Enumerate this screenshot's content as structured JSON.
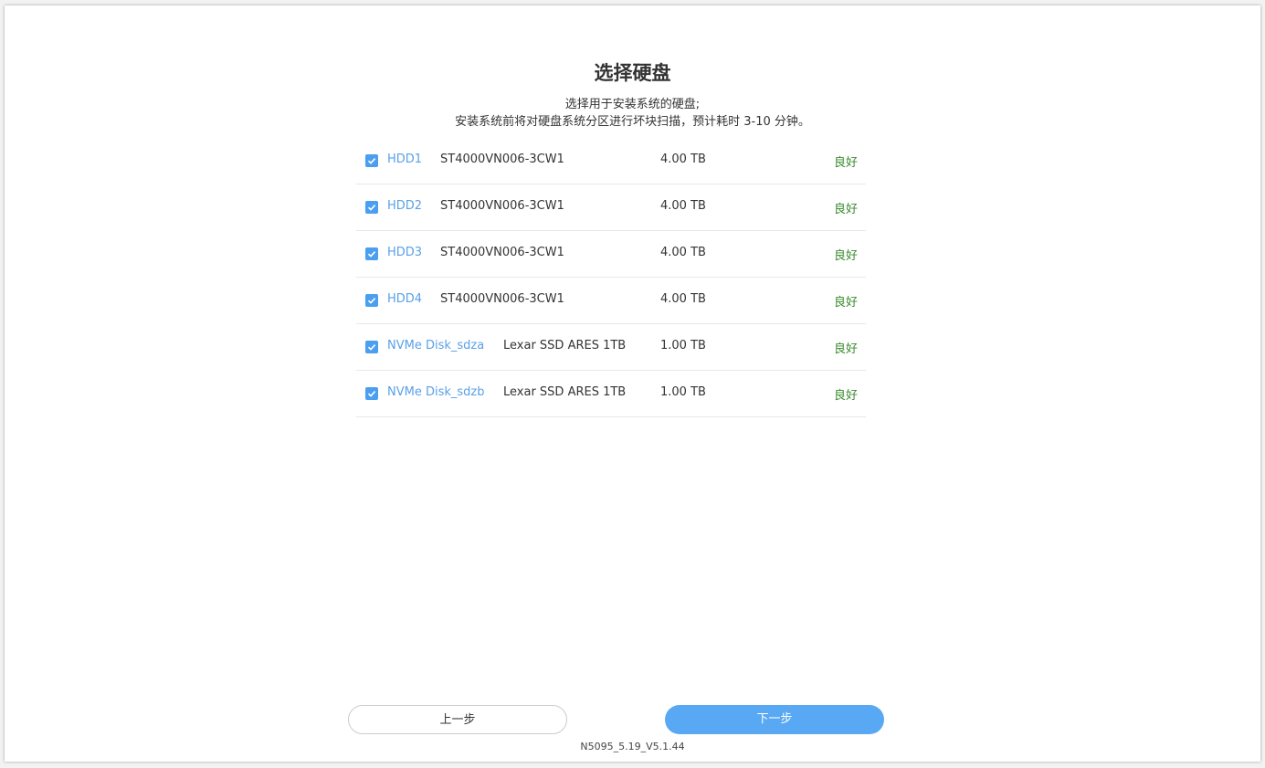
{
  "page": {
    "title": "选择硬盘",
    "subtitle_line1": "选择用于安装系统的硬盘;",
    "subtitle_line2": "安装系统前将对硬盘系统分区进行坏块扫描，预计耗时 3-10 分钟。"
  },
  "disks": [
    {
      "name": "HDD1",
      "model": "ST4000VN006-3CW1",
      "size": "4.00 TB",
      "status": "良好",
      "checked": true
    },
    {
      "name": "HDD2",
      "model": "ST4000VN006-3CW1",
      "size": "4.00 TB",
      "status": "良好",
      "checked": true
    },
    {
      "name": "HDD3",
      "model": "ST4000VN006-3CW1",
      "size": "4.00 TB",
      "status": "良好",
      "checked": true
    },
    {
      "name": "HDD4",
      "model": "ST4000VN006-3CW1",
      "size": "4.00 TB",
      "status": "良好",
      "checked": true
    },
    {
      "name": "NVMe Disk_sdza",
      "model": "Lexar SSD ARES 1TB",
      "size": "1.00 TB",
      "status": "良好",
      "checked": true
    },
    {
      "name": "NVMe Disk_sdzb",
      "model": "Lexar SSD ARES 1TB",
      "size": "1.00 TB",
      "status": "良好",
      "checked": true
    }
  ],
  "buttons": {
    "prev_label": "上一步",
    "next_label": "下一步"
  },
  "footer": {
    "version": "N5095_5.19_V5.1.44"
  },
  "colors": {
    "accent": "#58a8f4",
    "checkbox": "#4b9ff0",
    "disk_name": "#5aa0e8",
    "status_good": "#3a8a2e"
  },
  "icons": {
    "checkbox": "check-icon"
  }
}
